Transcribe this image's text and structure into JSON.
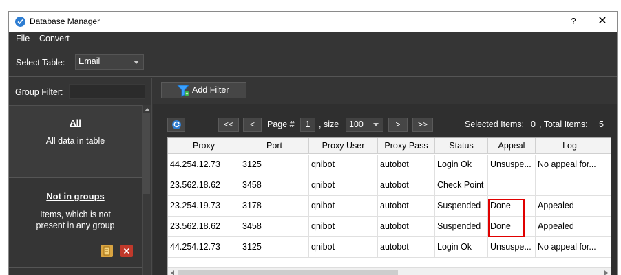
{
  "window": {
    "title": "Database Manager",
    "help": "?",
    "close": "✕"
  },
  "menu": {
    "items": [
      "File",
      "Convert"
    ]
  },
  "table_select": {
    "label": "Select Table:",
    "value": "Email"
  },
  "group_filter": {
    "label": "Group Filter:"
  },
  "groups": [
    {
      "title": "All",
      "desc_line1": "All data in table",
      "desc_line2": ""
    },
    {
      "title": "Not in groups",
      "desc_line1": "Items, which is not",
      "desc_line2": "present in any group"
    }
  ],
  "toolbar": {
    "add_filter": "Add Filter"
  },
  "pager": {
    "first": "<<",
    "prev": "<",
    "page_label": "Page #",
    "page": "1",
    "size_label": ", size",
    "size": "100",
    "next": ">",
    "last": ">>",
    "selected_label": "Selected Items:",
    "selected": "0",
    "total_label": ", Total Items:",
    "total": "5"
  },
  "grid": {
    "columns": [
      "Proxy",
      "Port",
      "Proxy User",
      "Proxy Pass",
      "Status",
      "Appeal",
      "Log"
    ],
    "rows": [
      [
        "44.254.12.73",
        "3125",
        "qnibot",
        "autobot",
        "Login Ok",
        "Unsuspe...",
        "No appeal for..."
      ],
      [
        "23.562.18.62",
        "3458",
        "qnibot",
        "autobot",
        "Check Point",
        "",
        ""
      ],
      [
        "23.254.19.73",
        "3178",
        "qnibot",
        "autobot",
        "Suspended",
        "Done",
        "Appealed"
      ],
      [
        "23.562.18.62",
        "3458",
        "qnibot",
        "autobot",
        "Suspended",
        "Done",
        "Appealed"
      ],
      [
        "44.254.12.73",
        "3125",
        "qnibot",
        "autobot",
        "Login Ok",
        "Unsuspe...",
        "No appeal for..."
      ]
    ]
  },
  "colors": {
    "dark_bg": "#353535",
    "accent": "#2d7dd2",
    "highlight": "#e00000"
  },
  "icons": [
    "app-check-icon",
    "filter-funnel-icon",
    "refresh-icon",
    "note-icon",
    "delete-icon"
  ]
}
